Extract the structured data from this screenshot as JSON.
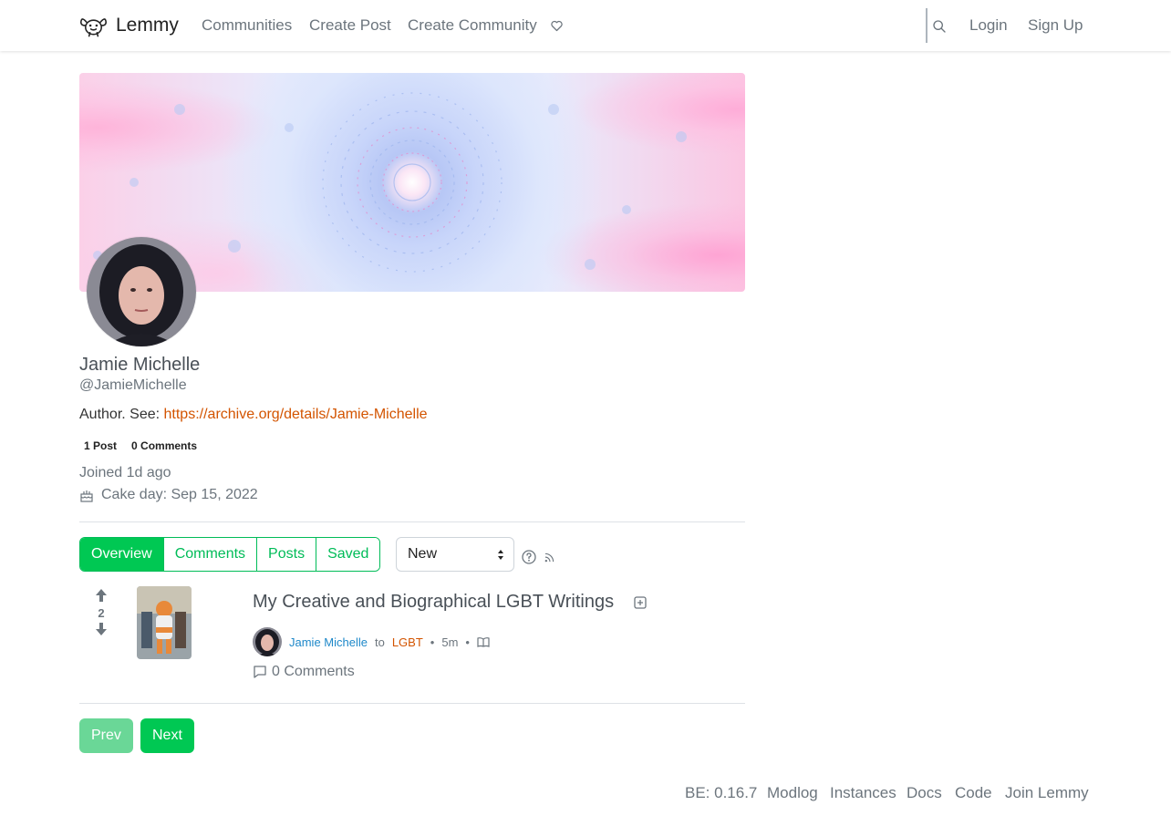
{
  "navbar": {
    "brand": "Lemmy",
    "links": [
      "Communities",
      "Create Post",
      "Create Community"
    ],
    "donate_icon": "heart-icon",
    "search_icon": "search-icon",
    "login": "Login",
    "signup": "Sign Up"
  },
  "profile": {
    "display_name": "Jamie Michelle",
    "handle": "@JamieMichelle",
    "bio_prefix": "Author. See:",
    "bio_link": "https://archive.org/details/Jamie-Michelle",
    "post_count": "1 Post",
    "comment_count": "0 Comments",
    "joined": "Joined 1d ago",
    "cake_day": "Cake day: Sep 15, 2022"
  },
  "tabs": [
    "Overview",
    "Comments",
    "Posts",
    "Saved"
  ],
  "active_tab": "Overview",
  "sort": {
    "selected": "New"
  },
  "post": {
    "score": "2",
    "title": "My Creative and Biographical LGBT Writings",
    "author": "Jamie Michelle",
    "to": "to",
    "community": "LGBT",
    "age": "5m",
    "comments": "0 Comments"
  },
  "pager": {
    "prev": "Prev",
    "next": "Next"
  },
  "footer": {
    "version": "BE: 0.16.7",
    "links": [
      "Modlog",
      "Instances",
      "Docs",
      "Code",
      "Join Lemmy"
    ]
  },
  "colors": {
    "accent": "#00c853",
    "link": "#d35400",
    "user": "#1e88c9"
  }
}
